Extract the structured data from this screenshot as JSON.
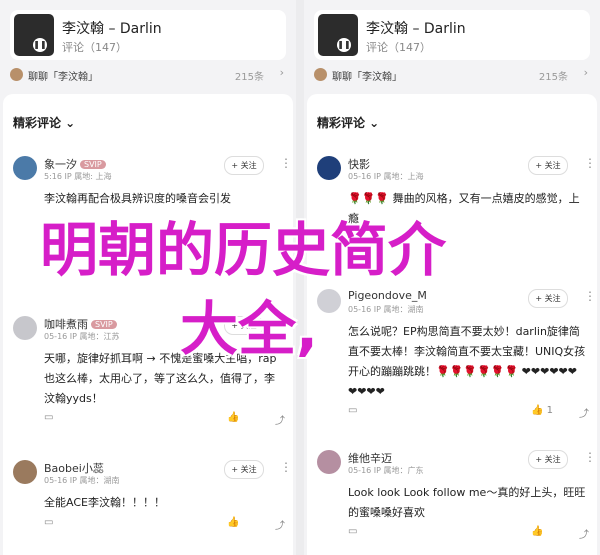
{
  "panels": [
    {
      "song": {
        "title": "李汶翰 – Darlin",
        "sub": "评论（147）"
      },
      "chat": {
        "text": "聊聊「李汶翰」",
        "count": "215条"
      },
      "sort_label": "精彩评论 ⌄",
      "comments": [
        {
          "user": "象一汐",
          "badge": "SVIP",
          "meta": "5:16 IP 属地: 上海",
          "follow": "+ 关注",
          "text": "李汶翰再配合极具辨识度的嗓音会引发",
          "actions": {
            "comment": "",
            "like": "",
            "share": ""
          }
        },
        {
          "user": "咖啡煮雨",
          "badge": "SVIP",
          "meta": "05-16 IP 属地：江苏",
          "follow": "+ 关注",
          "text": "天哪，旋律好抓耳啊 → 不愧是蜜嗓大主唱，rap也这么棒，太用心了，等了这么久，值得了，李汶翰yyds！",
          "actions": {
            "comment": "",
            "like": "",
            "share": ""
          }
        },
        {
          "user": "Baobei小蕊",
          "badge": "",
          "meta": "05-16 IP 属地：湖南",
          "follow": "+ 关注",
          "text": "全能ACE李汶翰！！！！",
          "actions": {
            "comment": "",
            "like": "",
            "share": ""
          }
        }
      ]
    },
    {
      "song": {
        "title": "李汶翰 – Darlin",
        "sub": "评论（147）"
      },
      "chat": {
        "text": "聊聊「李汶翰」",
        "count": "215条"
      },
      "sort_label": "精彩评论 ⌄",
      "comments": [
        {
          "user": "快影",
          "badge": "",
          "meta": "05-16 IP 属地：上海",
          "follow": "+ 关注",
          "text": "🌹🌹🌹 舞曲的风格，又有一点嬉皮的感觉，上瘾",
          "actions": {
            "comment": "",
            "like": "",
            "share": ""
          }
        },
        {
          "user": "Pigeondove_M",
          "badge": "",
          "meta": "05-16 IP 属地：湖南",
          "follow": "+ 关注",
          "text": "怎么说呢？EP构思简直不要太妙！darlin旋律简直不要太棒！李汶翰简直不要太宝藏！UNIQ女孩开心的蹦蹦跳跳！🌹🌹🌹🌹🌹🌹 ❤❤❤❤❤❤❤❤❤❤",
          "actions": {
            "comment": "",
            "like": "1",
            "share": ""
          }
        },
        {
          "user": "维他辛迈",
          "badge": "",
          "meta": "05-16 IP 属地：广东",
          "follow": "+ 关注",
          "text": "Look look Look follow me～真的好上头，旺旺的蜜嗓嗓好喜欢",
          "actions": {
            "comment": "",
            "like": "",
            "share": ""
          }
        }
      ]
    }
  ],
  "overlay": {
    "line1": "明朝的历史简介",
    "line2": "大全,"
  }
}
